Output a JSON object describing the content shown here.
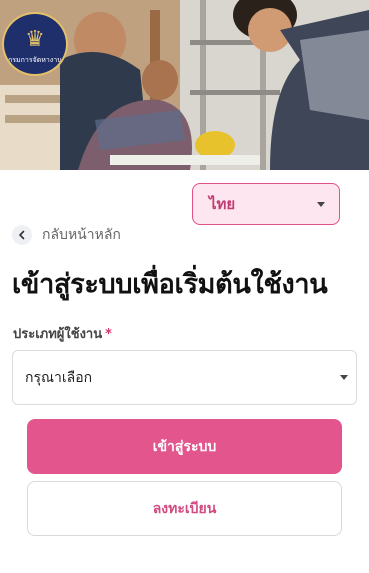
{
  "brand": {
    "logo_text": "กรมการจัดหางาน"
  },
  "language": {
    "selected": "ไทย"
  },
  "nav": {
    "back_label": "กลับหน้าหลัก"
  },
  "page": {
    "title": "เข้าสู่ระบบเพื่อเริ่มต้นใช้งาน"
  },
  "form": {
    "user_type_label": "ประเภทผู้ใช้งาน",
    "required_mark": "*",
    "user_type_value": "กรุณาเลือก"
  },
  "actions": {
    "login_label": "เข้าสู่ระบบ",
    "register_label": "ลงทะเบียน"
  },
  "colors": {
    "accent": "#e2558d",
    "accent_light": "#fde6ef",
    "accent_text": "#c43a73"
  }
}
